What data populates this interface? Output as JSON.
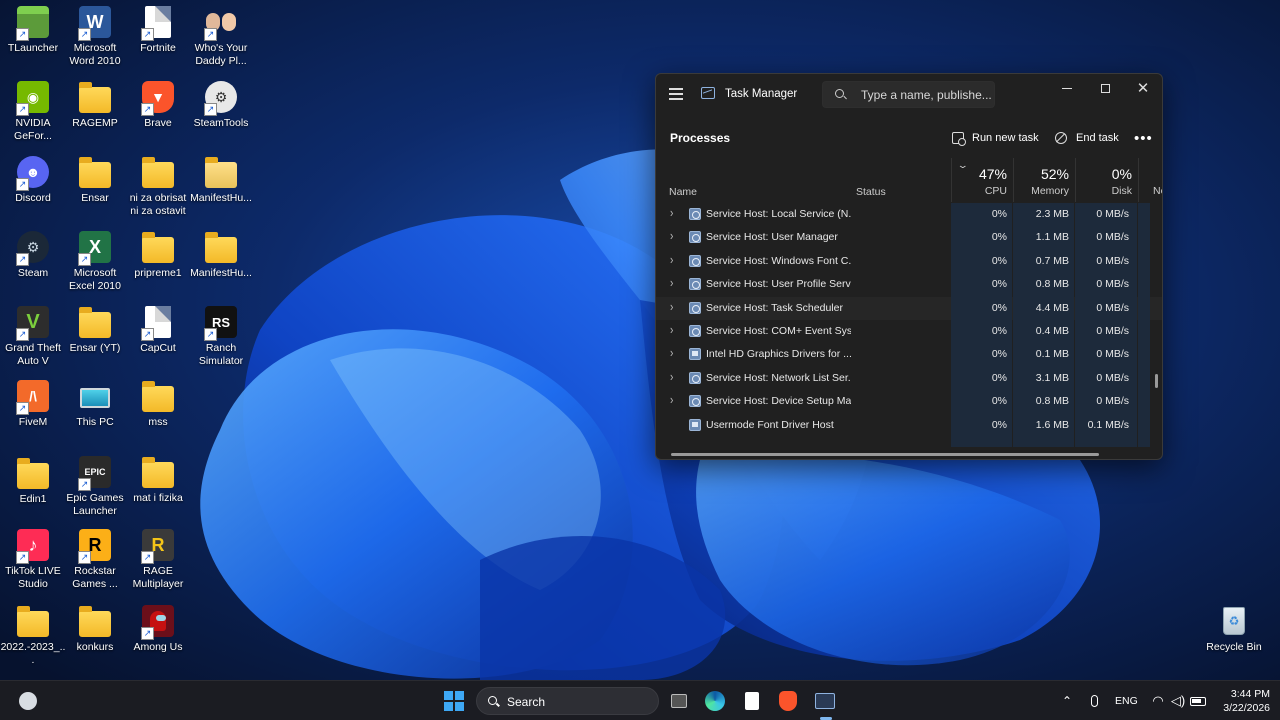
{
  "desktop": {
    "icons": [
      {
        "label": "TLauncher"
      },
      {
        "label": "Microsoft Word 2010"
      },
      {
        "label": "Fortnite"
      },
      {
        "label": "Who's Your Daddy Pl..."
      },
      {
        "label": "NVIDIA GeFor..."
      },
      {
        "label": "RAGEMP"
      },
      {
        "label": "Brave"
      },
      {
        "label": "SteamTools"
      },
      {
        "label": "Discord"
      },
      {
        "label": "Ensar"
      },
      {
        "label": "ni za obrisat ni za ostavit"
      },
      {
        "label": "ManifestHu..."
      },
      {
        "label": "Steam"
      },
      {
        "label": "Microsoft Excel 2010"
      },
      {
        "label": "pripreme1"
      },
      {
        "label": "ManifestHu..."
      },
      {
        "label": "Grand Theft Auto V"
      },
      {
        "label": "Ensar (YT)"
      },
      {
        "label": "CapCut"
      },
      {
        "label": "Ranch Simulator"
      },
      {
        "label": "FiveM"
      },
      {
        "label": "This PC"
      },
      {
        "label": "mss"
      },
      {
        "label": "Edin1"
      },
      {
        "label": "Epic Games Launcher"
      },
      {
        "label": "mat i fizika"
      },
      {
        "label": "TikTok LIVE Studio"
      },
      {
        "label": "Rockstar Games ..."
      },
      {
        "label": "RAGE Multiplayer"
      },
      {
        "label": "2022.-2023_..."
      },
      {
        "label": "konkurs"
      },
      {
        "label": "Among Us"
      },
      {
        "label": "Recycle Bin"
      }
    ],
    "tile_text": {
      "word": "W",
      "excel": "X",
      "gta": "V",
      "ranch": "RS",
      "fivem": "/\\",
      "epic": "EPIC",
      "rockstar": "R",
      "rage": "R",
      "tiktok": "♪"
    }
  },
  "taskmgr": {
    "title": "Task Manager",
    "search_placeholder": "Type a name, publishe...",
    "section": "Processes",
    "run_new_task": "Run new task",
    "end_task": "End task",
    "more": "•••",
    "columns": {
      "name": "Name",
      "status": "Status",
      "cpu_pct": "47%",
      "cpu": "CPU",
      "mem_pct": "52%",
      "mem": "Memory",
      "disk_pct": "0%",
      "disk": "Disk",
      "net": "Ne"
    },
    "rows": [
      {
        "name": "Service Host: Local Service (N...",
        "cpu": "0%",
        "mem": "2.3 MB",
        "disk": "0 MB/s"
      },
      {
        "name": "Service Host: User Manager",
        "cpu": "0%",
        "mem": "1.1 MB",
        "disk": "0 MB/s"
      },
      {
        "name": "Service Host: Windows Font C...",
        "cpu": "0%",
        "mem": "0.7 MB",
        "disk": "0 MB/s"
      },
      {
        "name": "Service Host: User Profile Servi...",
        "cpu": "0%",
        "mem": "0.8 MB",
        "disk": "0 MB/s"
      },
      {
        "name": "Service Host: Task Scheduler",
        "cpu": "0%",
        "mem": "4.4 MB",
        "disk": "0 MB/s"
      },
      {
        "name": "Service Host: COM+ Event Syst...",
        "cpu": "0%",
        "mem": "0.4 MB",
        "disk": "0 MB/s"
      },
      {
        "name": "Intel HD Graphics Drivers for ...",
        "cpu": "0%",
        "mem": "0.1 MB",
        "disk": "0 MB/s"
      },
      {
        "name": "Service Host: Network List Ser...",
        "cpu": "0%",
        "mem": "3.1 MB",
        "disk": "0 MB/s"
      },
      {
        "name": "Service Host: Device Setup Ma...",
        "cpu": "0%",
        "mem": "0.8 MB",
        "disk": "0 MB/s"
      },
      {
        "name": "Usermode Font Driver Host",
        "cpu": "0%",
        "mem": "1.6 MB",
        "disk": "0.1 MB/s"
      }
    ]
  },
  "taskbar": {
    "search_label": "Search",
    "language": "ENG",
    "time": "3:44 PM",
    "date": "3/22/2026"
  }
}
